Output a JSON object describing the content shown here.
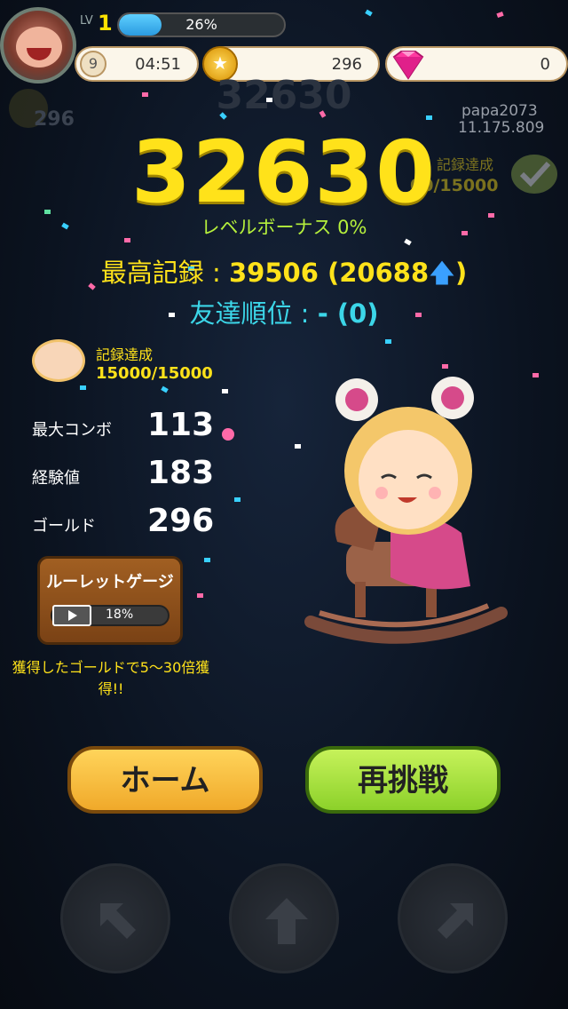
{
  "hud": {
    "level_label": "LV",
    "level": "1",
    "xp_percent": "26%",
    "xp_fraction": 0.26,
    "badge_number": "9",
    "timer": "04:51",
    "gold": "296",
    "gems": "0"
  },
  "score": {
    "ghost": "32630",
    "value": "32630",
    "level_bonus": "レベルボーナス 0%",
    "best_label": "最高記録 : ",
    "best_value": "39506 (20688",
    "best_close": ")",
    "rank_label": "友達順位 : ",
    "rank_value": "- (0)"
  },
  "friend": {
    "name": "papa2073",
    "score": "11.175.809",
    "achievement": "記録達成",
    "progress": "00/15000"
  },
  "ghost_gold": "296",
  "achievement": {
    "label": "記録達成",
    "progress": "15000/15000"
  },
  "stats": [
    {
      "label": "最大コンボ",
      "value": "113"
    },
    {
      "label": "経験値",
      "value": "183"
    },
    {
      "label": "ゴールド",
      "value": "296"
    }
  ],
  "roulette": {
    "title": "ルーレットゲージ",
    "percent": "18%",
    "note": "獲得したゴールドで5〜30倍獲得!!"
  },
  "buttons": {
    "home": "ホーム",
    "retry": "再挑戦"
  },
  "controls": [
    "arrow-up-left-icon",
    "arrow-up-icon",
    "arrow-up-right-icon"
  ],
  "colors": {
    "score": "#ffe21a",
    "bonus": "#b6f03c",
    "rank": "#3cd6e8",
    "home_button": "#f0a92a",
    "retry_button": "#8cd12a"
  }
}
